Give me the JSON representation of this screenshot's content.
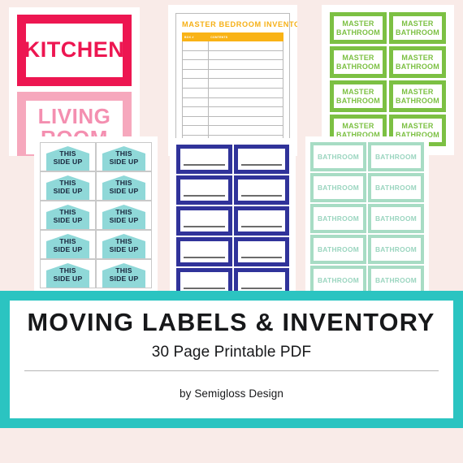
{
  "background": {
    "page_color": "#f9ebe8",
    "banner_color": "#2bc4c1"
  },
  "sheets": {
    "kitchen_living": {
      "labels": [
        {
          "text": "KITCHEN",
          "color": "#ed1651"
        },
        {
          "text": "LIVING ROOM",
          "color": "#f48fb0"
        }
      ]
    },
    "inventory": {
      "title": "MASTER BEDROOM INVENTORY",
      "accent_color": "#f9b316",
      "columns": [
        "BOX #",
        "CONTENTS"
      ],
      "row_count": 18
    },
    "master_bathroom": {
      "label_text": "MASTER BATHROOM",
      "color": "#7cc043",
      "columns": 2,
      "rows": 4
    },
    "this_side_up": {
      "label_text": "THIS SIDE UP",
      "arrow_color": "#8fd8d8",
      "text_color": "#18243b",
      "columns": 2,
      "rows": 5
    },
    "blank_navy": {
      "color": "#30339a",
      "columns": 2,
      "rows": 5
    },
    "bathroom_mint": {
      "label_text": "BATHROOM",
      "color": "#9ad5bf",
      "columns": 2,
      "rows": 5
    }
  },
  "banner": {
    "title": "MOVING LABELS & INVENTORY",
    "subtitle": "30 Page Printable PDF",
    "byline": "by Semigloss Design"
  }
}
